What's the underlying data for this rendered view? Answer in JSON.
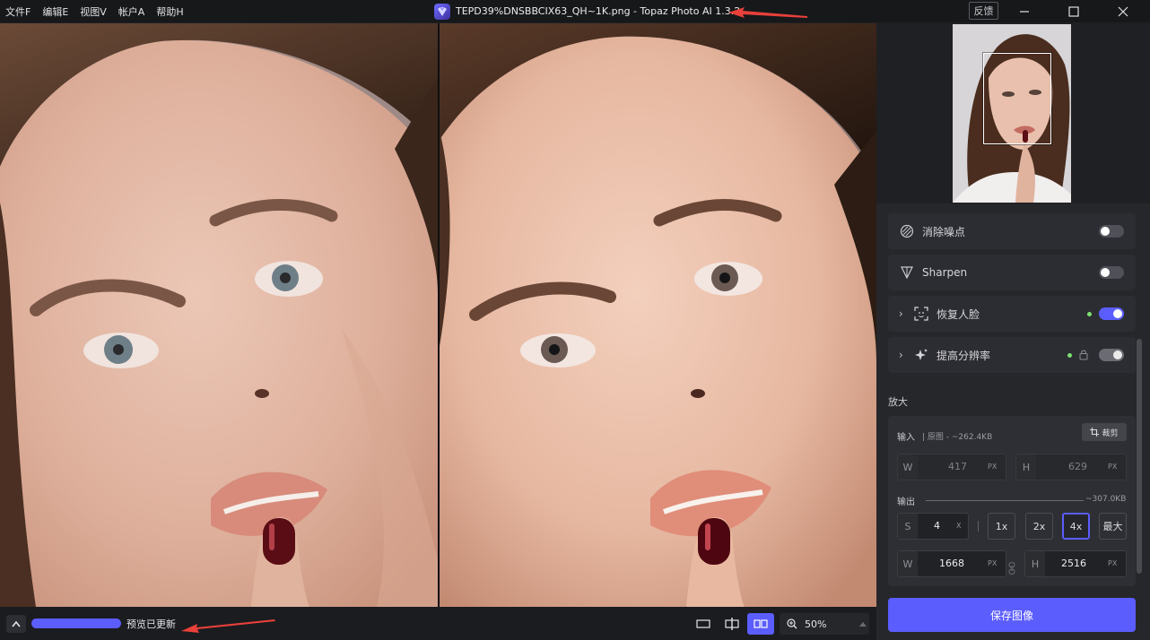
{
  "menu": [
    {
      "label": "文件F"
    },
    {
      "label": "编辑E"
    },
    {
      "label": "视图V"
    },
    {
      "label": "帐户A"
    },
    {
      "label": "帮助H"
    }
  ],
  "window": {
    "title": "TEPD39%DNSBBCIX63_QH~1K.png - Topaz Photo AI 1.3.2",
    "feedback_label": "反馈"
  },
  "bottombar": {
    "preview_status": "预览已更新",
    "zoom": "50%"
  },
  "panels": {
    "denoise": {
      "label": "消除噪点",
      "enabled": false
    },
    "sharpen": {
      "label": "Sharpen",
      "enabled": false
    },
    "face": {
      "label": "恢复人脸",
      "enabled": true
    },
    "upscale": {
      "label": "提高分辨率",
      "enabled": true,
      "locked": true
    }
  },
  "enlarge": {
    "section_label": "放大",
    "input_label": "输入",
    "input_info": "| 原图 -  ~262.4KB",
    "crop_label": "裁剪",
    "input_w_prefix": "W",
    "input_w": "417",
    "input_h_prefix": "H",
    "input_h": "629",
    "unit": "PX",
    "output_label": "输出",
    "output_size": "~307.0KB",
    "scale_prefix": "S",
    "scale_value": "4",
    "scale_unit": "X",
    "scale_options": [
      "1x",
      "2x",
      "4x",
      "最大"
    ],
    "scale_selected": "4x",
    "output_w_prefix": "W",
    "output_w": "1668",
    "output_h_prefix": "H",
    "output_h": "2516"
  },
  "save_label": "保存图像",
  "colors": {
    "accent": "#5b5dfd",
    "panel_bg": "#26272b",
    "arrow": "#e8403a",
    "status_dot": "#7be06f"
  }
}
